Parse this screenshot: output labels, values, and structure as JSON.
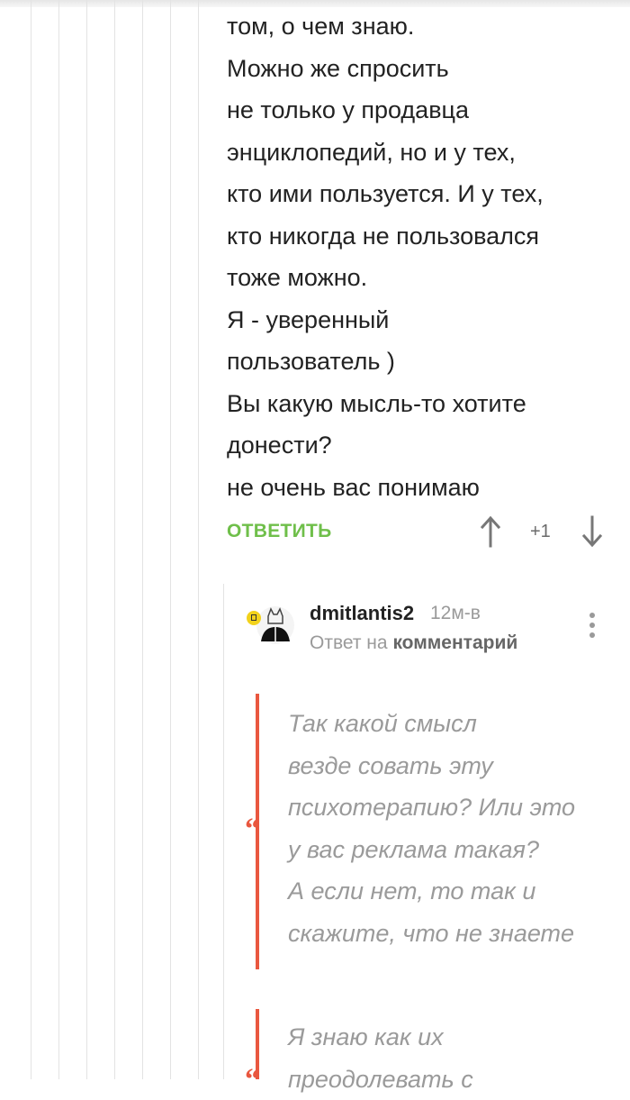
{
  "comment": {
    "lines": [
      "том, о чем знаю.",
      "Можно же спросить",
      "не только у продавца",
      "энциклопедий, но и у тех,",
      "кто ими пользуется. И у тех,",
      "кто никогда не пользовался",
      "тоже можно.",
      "Я - уверенный",
      "пользователь )",
      "Вы какую мысль-то хотите",
      "донести?",
      "не очень вас понимаю"
    ],
    "reply_label": "ОТВЕТИТЬ",
    "rating": "+1",
    "colors": {
      "reply": "#6fbf4a",
      "text": "#222222"
    }
  },
  "reply": {
    "username": "dmitlantis2",
    "time": "12м-в",
    "reply_to_prefix": "Ответ на",
    "reply_to_link": "комментарий",
    "quotes": [
      {
        "lines": [
          "Так какой смысл",
          "везде совать эту",
          "психотерапию? Или это",
          "у вас реклама такая?",
          "А если нет, то так и",
          "скажите, что не знаете"
        ]
      },
      {
        "lines": [
          "Я знаю как их",
          "преодолевать с"
        ]
      }
    ],
    "colors": {
      "quote_bar": "#e9573f",
      "quote_text": "#9a9a9a",
      "badge": "#f2d21b"
    },
    "icons": [
      "avatar-icon",
      "badge-icon",
      "more-options-icon",
      "quote-icon"
    ]
  },
  "icons": [
    "arrow-up-icon",
    "arrow-down-icon"
  ]
}
